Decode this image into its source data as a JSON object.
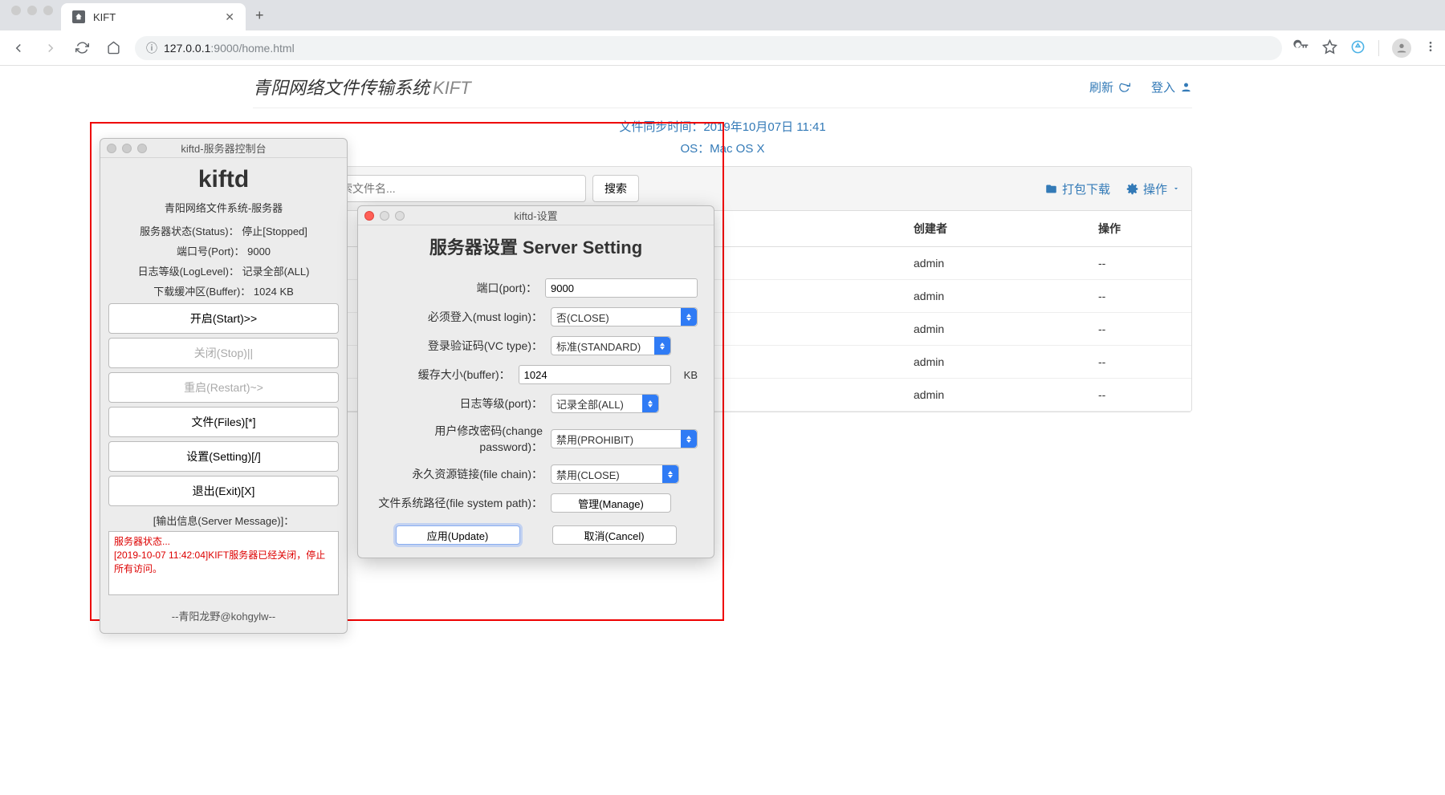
{
  "browser": {
    "tab_title": "KIFT",
    "url_info_icon": "ⓘ",
    "url_host": "127.0.0.1",
    "url_port": ":9000",
    "url_path": "/home.html"
  },
  "page": {
    "brand_main": "青阳网络文件传输系统",
    "brand_sub": "KIFT",
    "refresh_label": "刷新",
    "login_label": "登入",
    "sync_label": "文件同步时间：",
    "sync_time": "2019年10月07日 11:41",
    "os_label": "OS：",
    "os_value": "Mac OS X",
    "search_placeholder": "输入关键字搜索文件名...",
    "search_btn": "搜索",
    "download_label": "打包下载",
    "action_label": "操作",
    "table_headers": {
      "creator": "创建者",
      "action": "操作"
    },
    "rows": [
      {
        "creator": "admin",
        "action": "--"
      },
      {
        "creator": "admin",
        "action": "--"
      },
      {
        "creator": "admin",
        "action": "--"
      },
      {
        "creator": "admin",
        "action": "--"
      },
      {
        "creator": "admin",
        "action": "--"
      }
    ]
  },
  "console": {
    "title": "kiftd-服务器控制台",
    "logo": "kiftd",
    "subtitle": "青阳网络文件系统-服务器",
    "status_label": "服务器状态(Status)：",
    "status_value": "停止[Stopped]",
    "port_label": "端口号(Port)：",
    "port_value": "9000",
    "log_label": "日志等级(LogLevel)：",
    "log_value": "记录全部(ALL)",
    "buffer_label": "下载缓冲区(Buffer)：",
    "buffer_value": "1024 KB",
    "btn_start": "开启(Start)>>",
    "btn_stop": "关闭(Stop)||",
    "btn_restart": "重启(Restart)~>",
    "btn_files": "文件(Files)[*]",
    "btn_setting": "设置(Setting)[/]",
    "btn_exit": "退出(Exit)[X]",
    "msg_label": "[输出信息(Server Message)]：",
    "msg_line1": "服务器状态...",
    "msg_line2": "[2019-10-07 11:42:04]KIFT服务器已经关闭，停止所有访问。",
    "footer": "--青阳龙野@kohgylw--"
  },
  "settings": {
    "window_title": "kiftd-设置",
    "heading": "服务器设置 Server Setting",
    "port_label": "端口(port)：",
    "port_value": "9000",
    "mustlogin_label": "必须登入(must login)：",
    "mustlogin_value": "否(CLOSE)",
    "vctype_label": "登录验证码(VC type)：",
    "vctype_value": "标准(STANDARD)",
    "buffer_label": "缓存大小(buffer)：",
    "buffer_value": "1024",
    "buffer_unit": "KB",
    "loglevel_label": "日志等级(port)：",
    "loglevel_value": "记录全部(ALL)",
    "changepw_label": "用户修改密码(change password)：",
    "changepw_value": "禁用(PROHIBIT)",
    "filechain_label": "永久资源链接(file chain)：",
    "filechain_value": "禁用(CLOSE)",
    "fspath_label": "文件系统路径(file system path)：",
    "fspath_btn": "管理(Manage)",
    "btn_update": "应用(Update)",
    "btn_cancel": "取消(Cancel)"
  }
}
